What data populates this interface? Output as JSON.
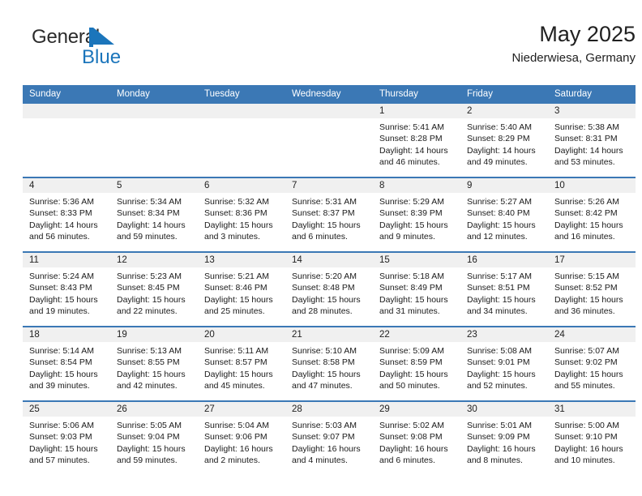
{
  "brand": {
    "name_top": "General",
    "name_bottom": "Blue",
    "mark": "flag-triangle-icon",
    "color_primary": "#1b75bb",
    "color_text": "#2b2b2b"
  },
  "header": {
    "title": "May 2025",
    "subtitle": "Niederwiesa, Germany"
  },
  "theme": {
    "header_bg": "#3b78b5",
    "daynum_bg": "#f0f0f0",
    "row_divider": "#3b78b5",
    "page_bg": "#ffffff"
  },
  "calendar": {
    "weekdays": [
      "Sunday",
      "Monday",
      "Tuesday",
      "Wednesday",
      "Thursday",
      "Friday",
      "Saturday"
    ],
    "labels": {
      "sunrise": "Sunrise:",
      "sunset": "Sunset:",
      "daylight": "Daylight:"
    },
    "weeks": [
      [
        {
          "day": "",
          "blank": true
        },
        {
          "day": "",
          "blank": true
        },
        {
          "day": "",
          "blank": true
        },
        {
          "day": "",
          "blank": true
        },
        {
          "day": "1",
          "sunrise": "Sunrise: 5:41 AM",
          "sunset": "Sunset: 8:28 PM",
          "daylight": "Daylight: 14 hours and 46 minutes."
        },
        {
          "day": "2",
          "sunrise": "Sunrise: 5:40 AM",
          "sunset": "Sunset: 8:29 PM",
          "daylight": "Daylight: 14 hours and 49 minutes."
        },
        {
          "day": "3",
          "sunrise": "Sunrise: 5:38 AM",
          "sunset": "Sunset: 8:31 PM",
          "daylight": "Daylight: 14 hours and 53 minutes."
        }
      ],
      [
        {
          "day": "4",
          "sunrise": "Sunrise: 5:36 AM",
          "sunset": "Sunset: 8:33 PM",
          "daylight": "Daylight: 14 hours and 56 minutes."
        },
        {
          "day": "5",
          "sunrise": "Sunrise: 5:34 AM",
          "sunset": "Sunset: 8:34 PM",
          "daylight": "Daylight: 14 hours and 59 minutes."
        },
        {
          "day": "6",
          "sunrise": "Sunrise: 5:32 AM",
          "sunset": "Sunset: 8:36 PM",
          "daylight": "Daylight: 15 hours and 3 minutes."
        },
        {
          "day": "7",
          "sunrise": "Sunrise: 5:31 AM",
          "sunset": "Sunset: 8:37 PM",
          "daylight": "Daylight: 15 hours and 6 minutes."
        },
        {
          "day": "8",
          "sunrise": "Sunrise: 5:29 AM",
          "sunset": "Sunset: 8:39 PM",
          "daylight": "Daylight: 15 hours and 9 minutes."
        },
        {
          "day": "9",
          "sunrise": "Sunrise: 5:27 AM",
          "sunset": "Sunset: 8:40 PM",
          "daylight": "Daylight: 15 hours and 12 minutes."
        },
        {
          "day": "10",
          "sunrise": "Sunrise: 5:26 AM",
          "sunset": "Sunset: 8:42 PM",
          "daylight": "Daylight: 15 hours and 16 minutes."
        }
      ],
      [
        {
          "day": "11",
          "sunrise": "Sunrise: 5:24 AM",
          "sunset": "Sunset: 8:43 PM",
          "daylight": "Daylight: 15 hours and 19 minutes."
        },
        {
          "day": "12",
          "sunrise": "Sunrise: 5:23 AM",
          "sunset": "Sunset: 8:45 PM",
          "daylight": "Daylight: 15 hours and 22 minutes."
        },
        {
          "day": "13",
          "sunrise": "Sunrise: 5:21 AM",
          "sunset": "Sunset: 8:46 PM",
          "daylight": "Daylight: 15 hours and 25 minutes."
        },
        {
          "day": "14",
          "sunrise": "Sunrise: 5:20 AM",
          "sunset": "Sunset: 8:48 PM",
          "daylight": "Daylight: 15 hours and 28 minutes."
        },
        {
          "day": "15",
          "sunrise": "Sunrise: 5:18 AM",
          "sunset": "Sunset: 8:49 PM",
          "daylight": "Daylight: 15 hours and 31 minutes."
        },
        {
          "day": "16",
          "sunrise": "Sunrise: 5:17 AM",
          "sunset": "Sunset: 8:51 PM",
          "daylight": "Daylight: 15 hours and 34 minutes."
        },
        {
          "day": "17",
          "sunrise": "Sunrise: 5:15 AM",
          "sunset": "Sunset: 8:52 PM",
          "daylight": "Daylight: 15 hours and 36 minutes."
        }
      ],
      [
        {
          "day": "18",
          "sunrise": "Sunrise: 5:14 AM",
          "sunset": "Sunset: 8:54 PM",
          "daylight": "Daylight: 15 hours and 39 minutes."
        },
        {
          "day": "19",
          "sunrise": "Sunrise: 5:13 AM",
          "sunset": "Sunset: 8:55 PM",
          "daylight": "Daylight: 15 hours and 42 minutes."
        },
        {
          "day": "20",
          "sunrise": "Sunrise: 5:11 AM",
          "sunset": "Sunset: 8:57 PM",
          "daylight": "Daylight: 15 hours and 45 minutes."
        },
        {
          "day": "21",
          "sunrise": "Sunrise: 5:10 AM",
          "sunset": "Sunset: 8:58 PM",
          "daylight": "Daylight: 15 hours and 47 minutes."
        },
        {
          "day": "22",
          "sunrise": "Sunrise: 5:09 AM",
          "sunset": "Sunset: 8:59 PM",
          "daylight": "Daylight: 15 hours and 50 minutes."
        },
        {
          "day": "23",
          "sunrise": "Sunrise: 5:08 AM",
          "sunset": "Sunset: 9:01 PM",
          "daylight": "Daylight: 15 hours and 52 minutes."
        },
        {
          "day": "24",
          "sunrise": "Sunrise: 5:07 AM",
          "sunset": "Sunset: 9:02 PM",
          "daylight": "Daylight: 15 hours and 55 minutes."
        }
      ],
      [
        {
          "day": "25",
          "sunrise": "Sunrise: 5:06 AM",
          "sunset": "Sunset: 9:03 PM",
          "daylight": "Daylight: 15 hours and 57 minutes."
        },
        {
          "day": "26",
          "sunrise": "Sunrise: 5:05 AM",
          "sunset": "Sunset: 9:04 PM",
          "daylight": "Daylight: 15 hours and 59 minutes."
        },
        {
          "day": "27",
          "sunrise": "Sunrise: 5:04 AM",
          "sunset": "Sunset: 9:06 PM",
          "daylight": "Daylight: 16 hours and 2 minutes."
        },
        {
          "day": "28",
          "sunrise": "Sunrise: 5:03 AM",
          "sunset": "Sunset: 9:07 PM",
          "daylight": "Daylight: 16 hours and 4 minutes."
        },
        {
          "day": "29",
          "sunrise": "Sunrise: 5:02 AM",
          "sunset": "Sunset: 9:08 PM",
          "daylight": "Daylight: 16 hours and 6 minutes."
        },
        {
          "day": "30",
          "sunrise": "Sunrise: 5:01 AM",
          "sunset": "Sunset: 9:09 PM",
          "daylight": "Daylight: 16 hours and 8 minutes."
        },
        {
          "day": "31",
          "sunrise": "Sunrise: 5:00 AM",
          "sunset": "Sunset: 9:10 PM",
          "daylight": "Daylight: 16 hours and 10 minutes."
        }
      ]
    ]
  }
}
